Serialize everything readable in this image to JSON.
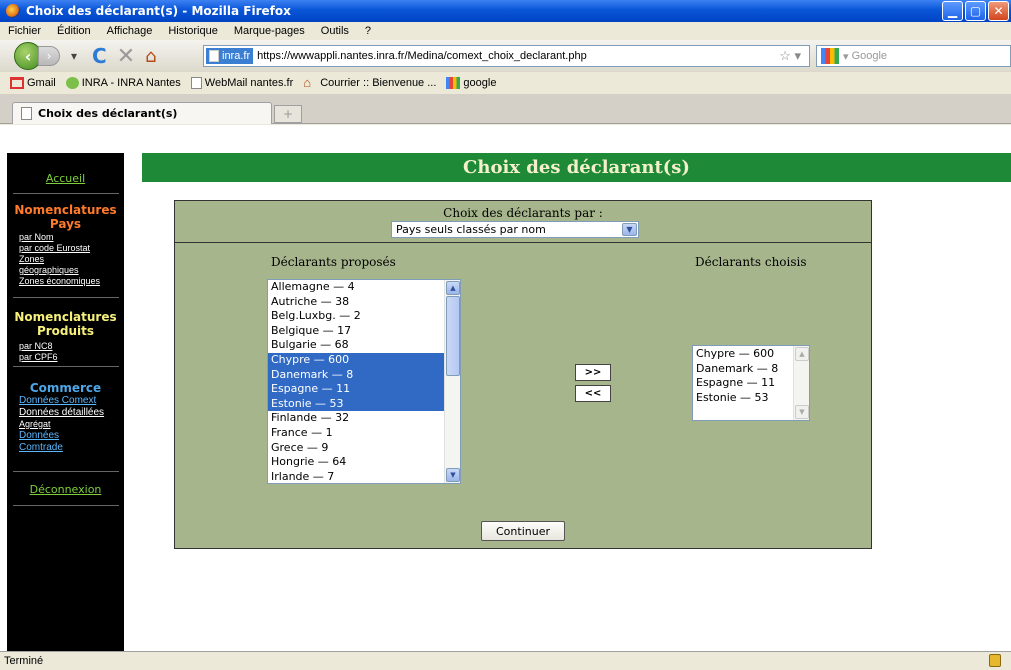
{
  "window": {
    "title": "Choix des déclarant(s) - Mozilla Firefox"
  },
  "menu": [
    "Fichier",
    "Édition",
    "Affichage",
    "Historique",
    "Marque-pages",
    "Outils",
    "?"
  ],
  "nav": {
    "site_badge": "inra.fr",
    "url": "https://wwwappli.nantes.inra.fr/Medina/comext_choix_declarant.php",
    "search_placeholder": "Google"
  },
  "bookmarks": [
    "Gmail",
    "INRA - INRA Nantes",
    "WebMail nantes.fr",
    "Courrier :: Bienvenue ...",
    "google"
  ],
  "tab": {
    "label": "Choix des déclarant(s)",
    "new_tab": "+"
  },
  "sidebar": {
    "home": "Accueil",
    "nom_pays": {
      "title1": "Nomenclatures",
      "title2": "Pays",
      "links": [
        "par Nom",
        "par code Eurostat",
        "Zones",
        "géographiques",
        "Zones économiques"
      ]
    },
    "nom_produits": {
      "title1": "Nomenclatures",
      "title2": "Produits",
      "links": [
        "par NC8",
        "par CPF6"
      ]
    },
    "commerce": {
      "title": "Commerce",
      "links": [
        "Données Comext",
        "Données détaillées",
        "Agrégat",
        "Données",
        "Comtrade"
      ]
    },
    "logout": "Déconnexion"
  },
  "banner": "Choix des déclarant(s)",
  "form": {
    "mode_label": "Choix des déclarants par :",
    "mode_value": "Pays seuls classés par nom",
    "proposed_label": "Déclarants proposés",
    "chosen_label": "Déclarants choisis",
    "proposed": [
      {
        "text": "Allemagne — 4",
        "selected": false
      },
      {
        "text": "Autriche — 38",
        "selected": false
      },
      {
        "text": "Belg.Luxbg. — 2",
        "selected": false
      },
      {
        "text": "Belgique — 17",
        "selected": false
      },
      {
        "text": "Bulgarie — 68",
        "selected": false
      },
      {
        "text": "Chypre — 600",
        "selected": true
      },
      {
        "text": "Danemark — 8",
        "selected": true
      },
      {
        "text": "Espagne — 11",
        "selected": true
      },
      {
        "text": "Estonie — 53",
        "selected": true
      },
      {
        "text": "Finlande — 32",
        "selected": false
      },
      {
        "text": "France — 1",
        "selected": false
      },
      {
        "text": "Grece — 9",
        "selected": false
      },
      {
        "text": "Hongrie — 64",
        "selected": false
      },
      {
        "text": "Irlande — 7",
        "selected": false
      }
    ],
    "chosen": [
      "Chypre — 600",
      "Danemark — 8",
      "Espagne — 11",
      "Estonie — 53"
    ],
    "add_label": ">>",
    "remove_label": "<<",
    "continue_label": "Continuer"
  },
  "status": "Terminé"
}
